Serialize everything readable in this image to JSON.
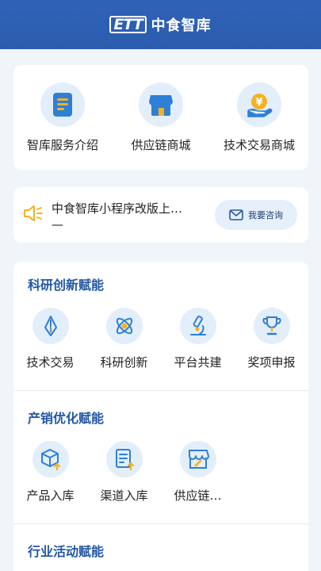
{
  "header": {
    "logo_mark": "ETT",
    "title": "中食智库"
  },
  "top_services": [
    {
      "label": "智库服务介绍",
      "icon": "document-icon"
    },
    {
      "label": "供应链商城",
      "icon": "store-icon"
    },
    {
      "label": "技术交易商城",
      "icon": "yuan-hand-icon"
    }
  ],
  "notice": {
    "icon": "megaphone-icon",
    "line1": "中食智库小程序改版上…",
    "line2": "—",
    "consult_label": "我要咨询"
  },
  "sections": [
    {
      "title": "科研创新赋能",
      "items": [
        {
          "label": "技术交易",
          "icon": "pen-nib-icon"
        },
        {
          "label": "科研创新",
          "icon": "atom-icon"
        },
        {
          "label": "平台共建",
          "icon": "microscope-icon"
        },
        {
          "label": "奖项申报",
          "icon": "trophy-icon"
        }
      ]
    },
    {
      "title": "产销优化赋能",
      "items": [
        {
          "label": "产品入库",
          "icon": "box-upload-icon"
        },
        {
          "label": "渠道入库",
          "icon": "list-upload-icon"
        },
        {
          "label": "供应链…",
          "icon": "store-link-icon"
        }
      ]
    },
    {
      "title": "行业活动赋能",
      "items": []
    }
  ],
  "colors": {
    "brand": "#2b5cad",
    "accent": "#2e7fd6",
    "highlight": "#f5b220",
    "icon_bg": "#e3eefb"
  }
}
